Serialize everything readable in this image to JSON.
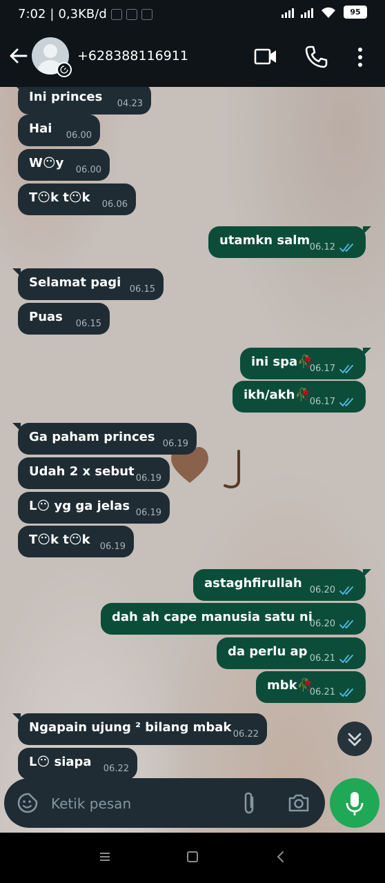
{
  "status_bar": {
    "time": "7:02",
    "data_speed": "0,3KB/d",
    "battery": "95"
  },
  "header": {
    "contact_name": "+628388116911"
  },
  "messages": [
    {
      "direction": "in",
      "text": "Ini princes",
      "time": "04.23"
    },
    {
      "direction": "in",
      "text": "Hai",
      "time": "06.00"
    },
    {
      "direction": "in",
      "text": "W😶y",
      "time": "06.00"
    },
    {
      "direction": "in",
      "text": "T😶k t😶k",
      "time": "06.06"
    },
    {
      "direction": "out",
      "text": "utamkn salm",
      "time": "06.12",
      "read": true
    },
    {
      "direction": "in",
      "text": "Selamat pagi",
      "time": "06.15"
    },
    {
      "direction": "in",
      "text": "Puas",
      "time": "06.15"
    },
    {
      "direction": "out",
      "text": "ini spa🥀",
      "time": "06.17",
      "read": true
    },
    {
      "direction": "out",
      "text": "ikh/akh🥀",
      "time": "06.17",
      "read": true
    },
    {
      "direction": "in",
      "text": "Ga paham princes",
      "time": "06.19"
    },
    {
      "direction": "in",
      "text": "Udah 2 x sebut",
      "time": "06.19"
    },
    {
      "direction": "in",
      "text": "L😶 yg ga jelas",
      "time": "06.19"
    },
    {
      "direction": "in",
      "text": "T😶k t😶k",
      "time": "06.19"
    },
    {
      "direction": "out",
      "text": "astaghfirullah",
      "time": "06.20",
      "read": true
    },
    {
      "direction": "out",
      "text": "dah ah cape manusia satu ni",
      "time": "06.20",
      "read": true
    },
    {
      "direction": "out",
      "text": "da perlu ap",
      "time": "06.21",
      "read": true
    },
    {
      "direction": "out",
      "text": "mbk🥀",
      "time": "06.21",
      "read": true
    },
    {
      "direction": "in",
      "text": "Ngapain ujung ² bilang mbak",
      "time": "06.22"
    },
    {
      "direction": "in",
      "text": "L😶 siapa",
      "time": "06.22"
    }
  ],
  "input": {
    "placeholder": "Ketik pesan"
  },
  "colors": {
    "header_bg": "#0e1417",
    "incoming_bubble": "#1f2c34",
    "outgoing_bubble": "#0c4d3a",
    "read_ticks": "#53bdeb",
    "mic_button": "#1fa855",
    "chat_wallpaper": "#c6bfba"
  },
  "icons": {
    "back": "arrow-left-icon",
    "video": "video-camera-icon",
    "call": "phone-icon",
    "menu": "more-vertical-icon",
    "sticker": "sticker-smile-icon",
    "attach": "paperclip-icon",
    "camera": "camera-icon",
    "mic": "microphone-icon",
    "scroll": "double-chevron-down-icon"
  }
}
